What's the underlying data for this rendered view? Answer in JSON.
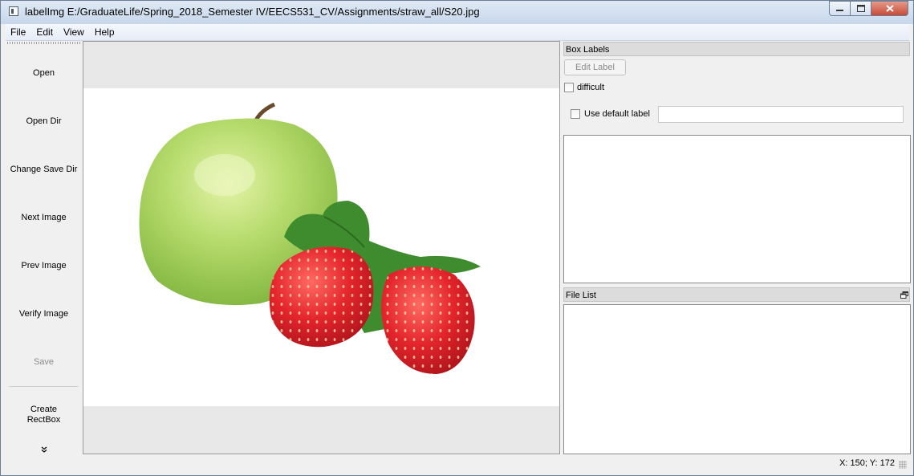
{
  "window": {
    "app_name": "labelImg",
    "file_path": "E:/GraduateLife/Spring_2018_Semester IV/EECS531_CV/Assignments/straw_all/S20.jpg"
  },
  "menu": [
    "File",
    "Edit",
    "View",
    "Help"
  ],
  "toolbar": {
    "open": "Open",
    "open_dir": "Open Dir",
    "change_save_dir": "Change Save Dir",
    "next_image": "Next Image",
    "prev_image": "Prev Image",
    "verify_image": "Verify Image",
    "save": "Save",
    "create_rectbox_line1": "Create",
    "create_rectbox_line2": "RectBox",
    "more_icon": "double-chevron-down-icon"
  },
  "box_labels": {
    "title": "Box Labels",
    "edit_label": "Edit Label",
    "difficult": "difficult",
    "difficult_checked": false,
    "use_default_label": "Use default label",
    "use_default_checked": false,
    "default_label_value": ""
  },
  "file_list": {
    "title": "File List",
    "float_icon": "float-dock-icon"
  },
  "status": {
    "coords": "X: 150; Y: 172"
  },
  "image": {
    "subject": "green apple and two strawberries",
    "colors": {
      "apple": "#a9d25b",
      "strawberry": "#e02a2f",
      "leaf": "#3e8a2c"
    }
  }
}
